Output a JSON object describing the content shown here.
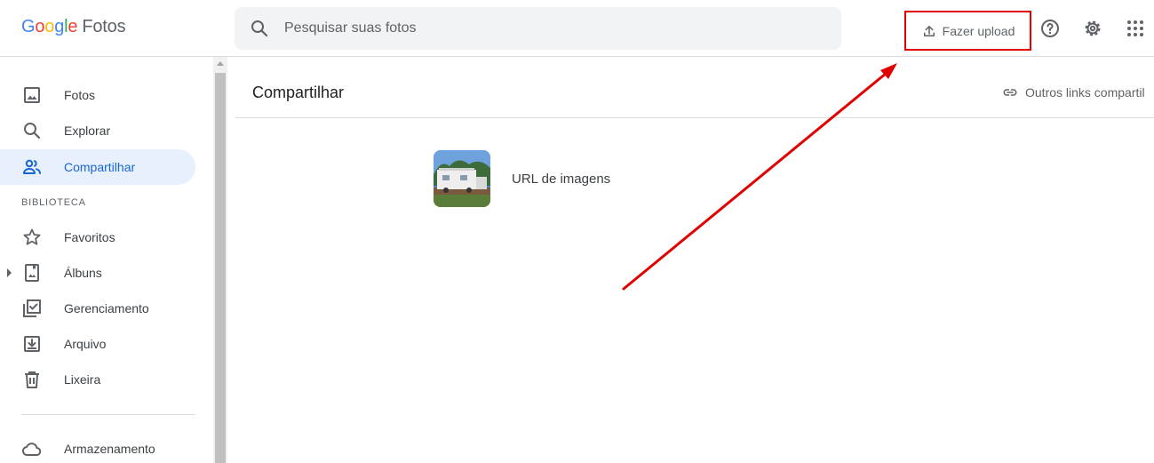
{
  "header": {
    "logo": {
      "letters": [
        "G",
        "o",
        "o",
        "g",
        "l",
        "e"
      ],
      "product": "Fotos"
    },
    "search_placeholder": "Pesquisar suas fotos",
    "upload_label": "Fazer upload"
  },
  "sidebar": {
    "items": [
      {
        "label": "Fotos",
        "icon": "photo-icon"
      },
      {
        "label": "Explorar",
        "icon": "search-icon"
      },
      {
        "label": "Compartilhar",
        "icon": "people-icon",
        "active": true
      }
    ],
    "library_label": "BIBLIOTECA",
    "library_items": [
      {
        "label": "Favoritos",
        "icon": "star-icon"
      },
      {
        "label": "Álbuns",
        "icon": "album-icon"
      },
      {
        "label": "Gerenciamento",
        "icon": "manage-icon"
      },
      {
        "label": "Arquivo",
        "icon": "archive-icon"
      },
      {
        "label": "Lixeira",
        "icon": "trash-icon"
      }
    ],
    "storage_label": "Armazenamento"
  },
  "main": {
    "title": "Compartilhar",
    "other_links": "Outros links compartil",
    "shared": [
      {
        "label": "URL de imagens"
      }
    ]
  },
  "colors": {
    "accent": "#1967d2",
    "active_bg": "#e8f0fe",
    "annotation": "#e00000"
  }
}
